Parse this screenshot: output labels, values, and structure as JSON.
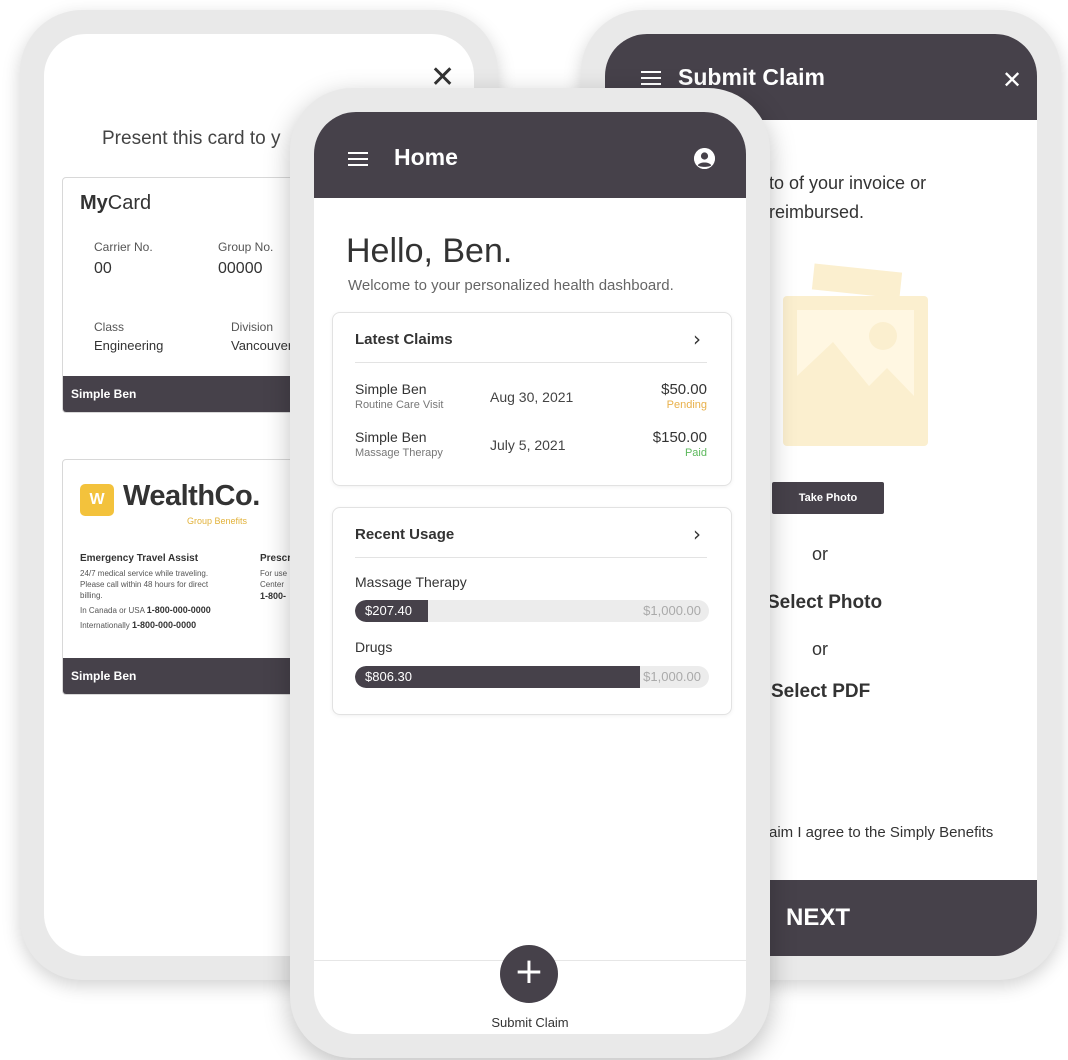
{
  "cards_screen": {
    "close_icon": "close-icon",
    "present_text": "Present this card to y",
    "mycard": {
      "brand_prefix": "My",
      "brand_suffix": "Card",
      "carrier_label": "Carrier No.",
      "carrier_value": "00",
      "group_label": "Group No.",
      "group_value": "00000",
      "class_label": "Class",
      "class_value": "Engineering",
      "division_label": "Division",
      "division_value": "Vancouver",
      "holder": "Simple Ben"
    },
    "wealthco": {
      "logo_letter": "W",
      "brand": "WealthCo.",
      "sub": "Group Benefits",
      "travel_title": "Emergency Travel Assist",
      "travel_line1": "24/7 medical service while traveling.",
      "travel_line2": "Please call within 48 hours for direct",
      "travel_line3": "billing.",
      "canada_prefix": "In Canada or USA ",
      "canada_phone": "1-800-000-0000",
      "intl_prefix": "Internationally ",
      "intl_phone": "1-800-000-0000",
      "presc_title": "Prescr",
      "presc_line1": "For use",
      "presc_line2": "Center",
      "presc_phone": "1-800-",
      "holder": "Simple Ben"
    }
  },
  "claim_screen": {
    "title": "Submit Claim",
    "instructions_line1": "to of your invoice or",
    "instructions_line2": "reimbursed.",
    "take_photo": "Take Photo",
    "or1": "or",
    "select_photo": "Select Photo",
    "or2": "or",
    "select_pdf": "Select PDF",
    "agreement": "aim I agree to the Simply Benefits",
    "next": "NEXT"
  },
  "home_screen": {
    "title": "Home",
    "greeting": "Hello, Ben.",
    "welcome": "Welcome to your personalized health dashboard.",
    "latest_claims": {
      "title": "Latest Claims",
      "items": [
        {
          "name": "Simple Ben",
          "type": "Routine Care Visit",
          "date": "Aug 30, 2021",
          "amount": "$50.00",
          "status": "Pending",
          "status_color": "#e8b04a"
        },
        {
          "name": "Simple Ben",
          "type": "Massage Therapy",
          "date": "July 5, 2021",
          "amount": "$150.00",
          "status": "Paid",
          "status_color": "#5cb85c"
        }
      ]
    },
    "recent_usage": {
      "title": "Recent Usage",
      "items": [
        {
          "label": "Massage Therapy",
          "used": "$207.40",
          "max": "$1,000.00",
          "fraction": 0.2074
        },
        {
          "label": "Drugs",
          "used": "$806.30",
          "max": "$1,000.00",
          "fraction": 0.8063
        }
      ]
    },
    "fab_label": "Submit Claim"
  },
  "colors": {
    "header": "#46414a",
    "accent_yellow": "#f3c23c",
    "pending": "#e8b04a",
    "paid": "#5cb85c"
  }
}
